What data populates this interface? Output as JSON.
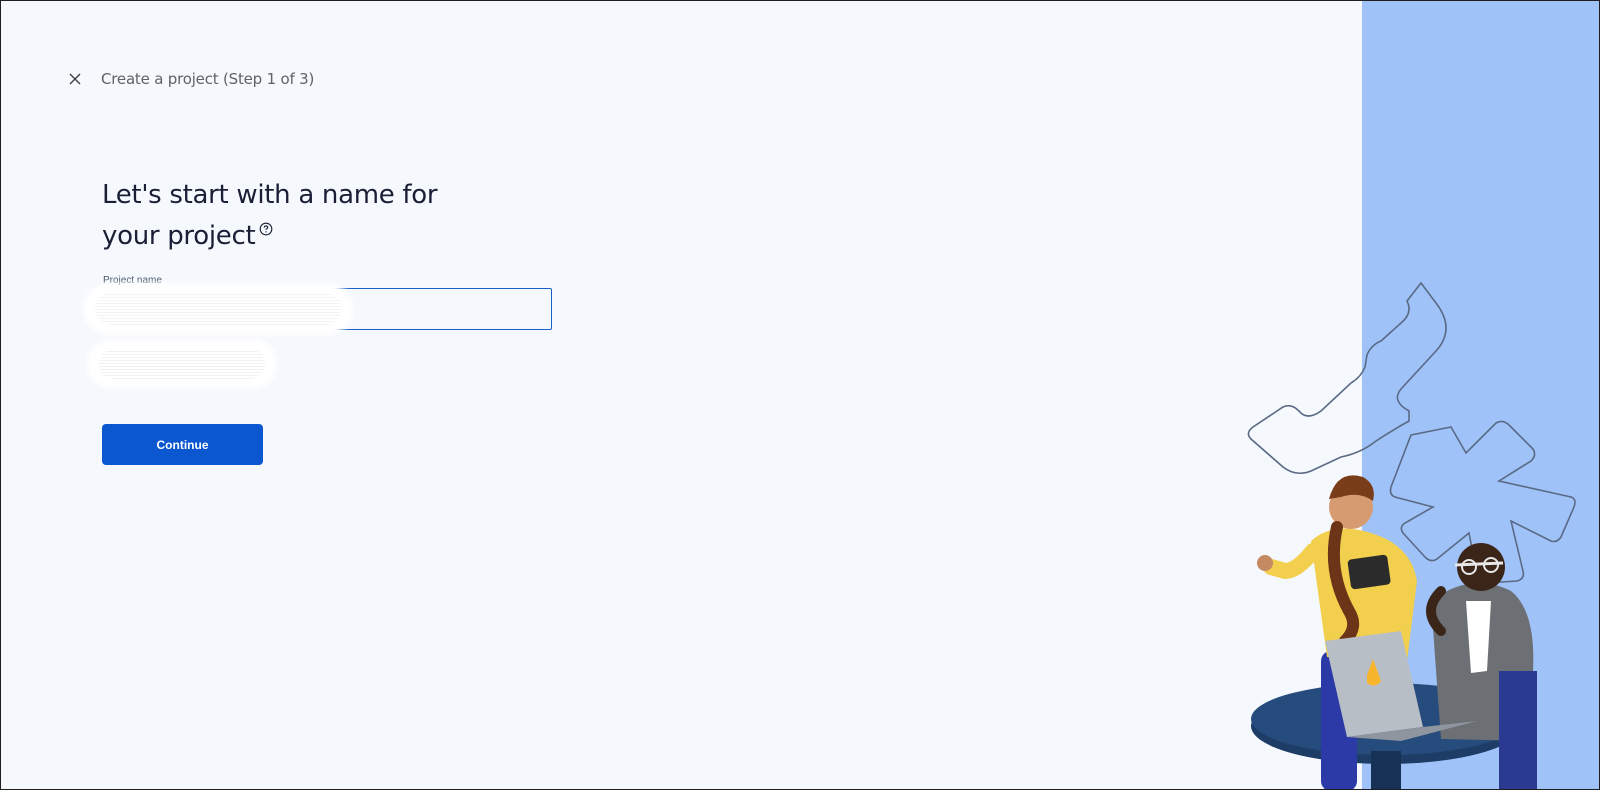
{
  "header": {
    "close_icon": "close-icon",
    "title": "Create a project (Step 1 of 3)"
  },
  "main": {
    "heading_line1": "Let's start with a name for",
    "heading_line2": "your project",
    "help_icon": "help-circle-icon",
    "field_label": "Project name",
    "field_value": "",
    "continue_label": "Continue"
  },
  "colors": {
    "page_background": "#f5f8fc",
    "right_panel": "#9fc2f9",
    "primary_button": "#0b57d0",
    "field_border": "#1a5fc8",
    "heading_text": "#1a1f36"
  }
}
